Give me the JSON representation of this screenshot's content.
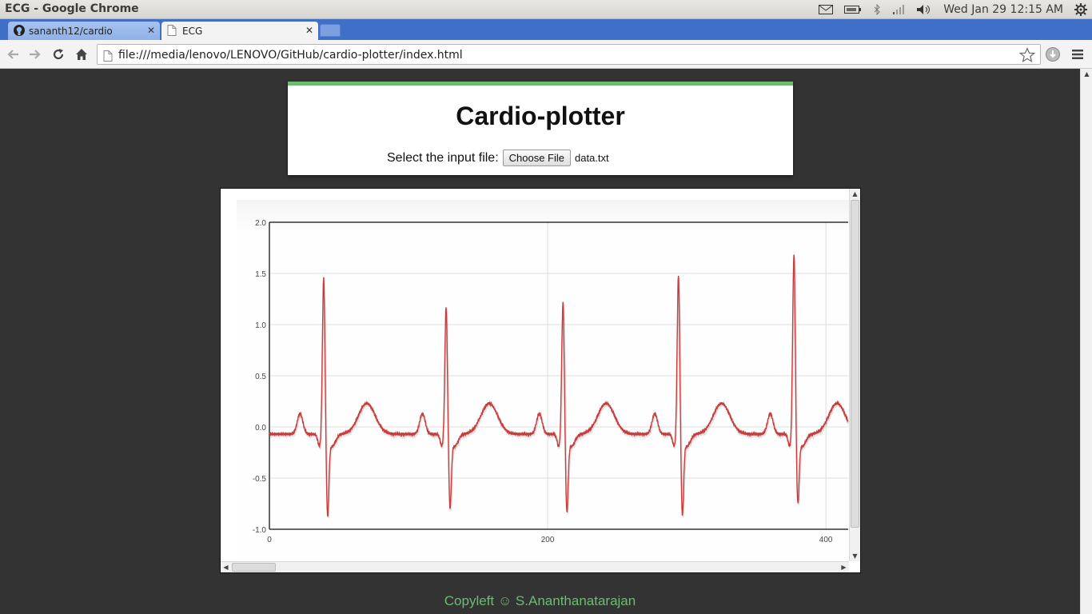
{
  "os": {
    "window_title": "ECG - Google Chrome",
    "clock": "Wed Jan 29  12:15 AM"
  },
  "browser": {
    "tabs": [
      {
        "label": "sananth12/cardio",
        "icon": "github-icon",
        "active": false
      },
      {
        "label": "ECG",
        "icon": "page-icon",
        "active": true
      }
    ],
    "url": "file:///media/lenovo/LENOVO/GitHub/cardio-plotter/index.html"
  },
  "page": {
    "title": "Cardio-plotter",
    "file_prompt": "Select the input file:",
    "choose_button": "Choose File",
    "file_name": "data.txt",
    "footer": "Copyleft ☺ S.Ananthanatarajan"
  },
  "colors": {
    "accent": "#6dbb72",
    "line": "#c83c3c",
    "background": "#333333"
  },
  "chart_data": {
    "type": "line",
    "title": "",
    "xlabel": "",
    "ylabel": "",
    "xlim": [
      0,
      416
    ],
    "ylim": [
      -1.0,
      2.0
    ],
    "xticks": [
      "0",
      "200",
      "400"
    ],
    "yticks": [
      "2.0",
      "1.5",
      "1.0",
      "0.5",
      "0.0",
      "-0.5",
      "-1.0"
    ],
    "grid": true,
    "beats": [
      {
        "r_x": 39,
        "r_peak": 1.47,
        "s_min": -0.83
      },
      {
        "r_x": 127,
        "r_peak": 1.19,
        "s_min": -0.75
      },
      {
        "r_x": 211,
        "r_peak": 1.23,
        "s_min": -0.79
      },
      {
        "r_x": 294,
        "r_peak": 1.5,
        "s_min": -0.82
      },
      {
        "r_x": 377,
        "r_peak": 1.7,
        "s_min": -0.71
      }
    ],
    "baseline": -0.07,
    "p_wave_amplitude": 0.2,
    "t_wave_amplitude": 0.25,
    "series": [
      {
        "values_source": "data.txt"
      }
    ]
  }
}
